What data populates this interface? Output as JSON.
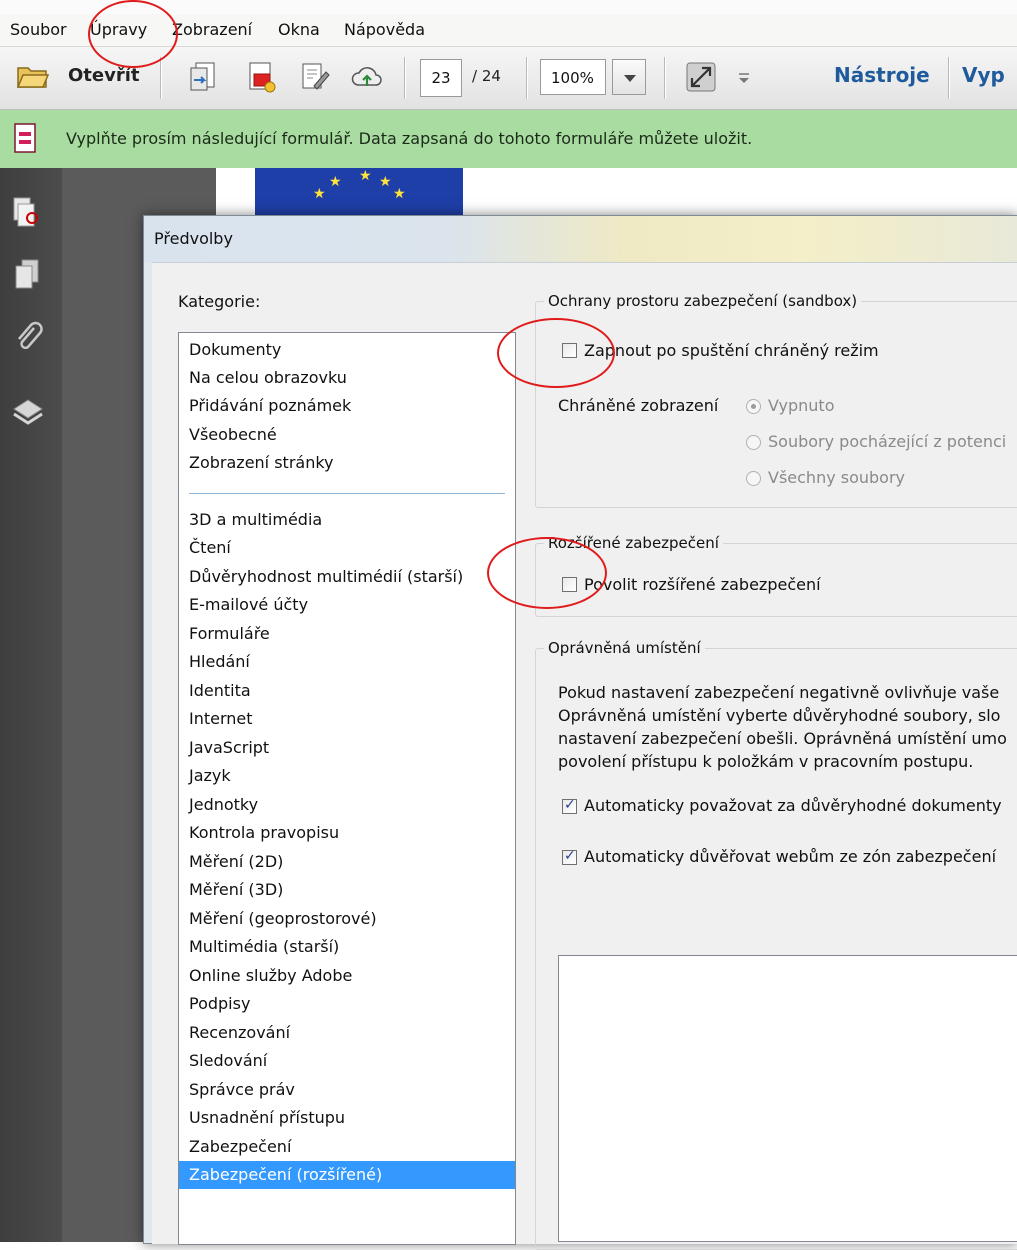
{
  "menu": [
    "Soubor",
    "Úpravy",
    "Zobrazení",
    "Okna",
    "Nápověda"
  ],
  "toolbar": {
    "open_label": "Otevřít",
    "page_current": "23",
    "page_total": "/ 24",
    "zoom": "100%",
    "tools_label": "Nástroje",
    "fill_label": "Vyp"
  },
  "notice": {
    "text": "Vyplňte prosím následující formulář. Data zapsaná do tohoto formuláře můžete uložit."
  },
  "dialog": {
    "title": "Předvolby",
    "category_label": "Kategorie:",
    "categories_top": [
      "Dokumenty",
      "Na celou obrazovku",
      "Přidávání poznámek",
      "Všeobecné",
      "Zobrazení stránky"
    ],
    "categories": [
      "3D a multimédia",
      "Čtení",
      "Důvěryhodnost multimédií (starší)",
      "E-mailové účty",
      "Formuláře",
      "Hledání",
      "Identita",
      "Internet",
      "JavaScript",
      "Jazyk",
      "Jednotky",
      "Kontrola pravopisu",
      "Měření (2D)",
      "Měření (3D)",
      "Měření (geoprostorové)",
      "Multimédia (starší)",
      "Online služby Adobe",
      "Podpisy",
      "Recenzování",
      "Sledování",
      "Správce práv",
      "Usnadnění přístupu",
      "Zabezpečení",
      "Zabezpečení (rozšířené)"
    ],
    "selected_category": "Zabezpečení (rozšířené)"
  },
  "sandbox": {
    "legend": "Ochrany prostoru zabezpečení (sandbox)",
    "protected_mode_label": "Zapnout po spuštění chráněný režim",
    "protected_mode_checked": false,
    "protected_view_label": "Chráněné zobrazení",
    "pv_options": [
      "Vypnuto",
      "Soubory pocházející z potenci",
      "Všechny soubory"
    ],
    "pv_selected": "Vypnuto"
  },
  "enhanced": {
    "legend": "Rozšířené zabezpečení",
    "enable_label": "Povolit rozšířené zabezpečení",
    "enable_checked": false
  },
  "privileged": {
    "legend": "Oprávněná umístění",
    "desc_lines": [
      "Pokud nastavení zabezpečení negativně ovlivňuje vaše",
      "Oprávněná umístění vyberte důvěryhodné soubory, slo",
      "nastavení zabezpečení obešli. Oprávněná umístění umo",
      "povolení přístupu k položkám v pracovním postupu."
    ],
    "auto_trust_docs_label": "Automaticky považovat za důvěryhodné dokumenty",
    "auto_trust_docs_checked": true,
    "auto_trust_sites_label": "Automaticky důvěřovat webům ze zón zabezpečení",
    "auto_trust_sites_checked": true
  }
}
